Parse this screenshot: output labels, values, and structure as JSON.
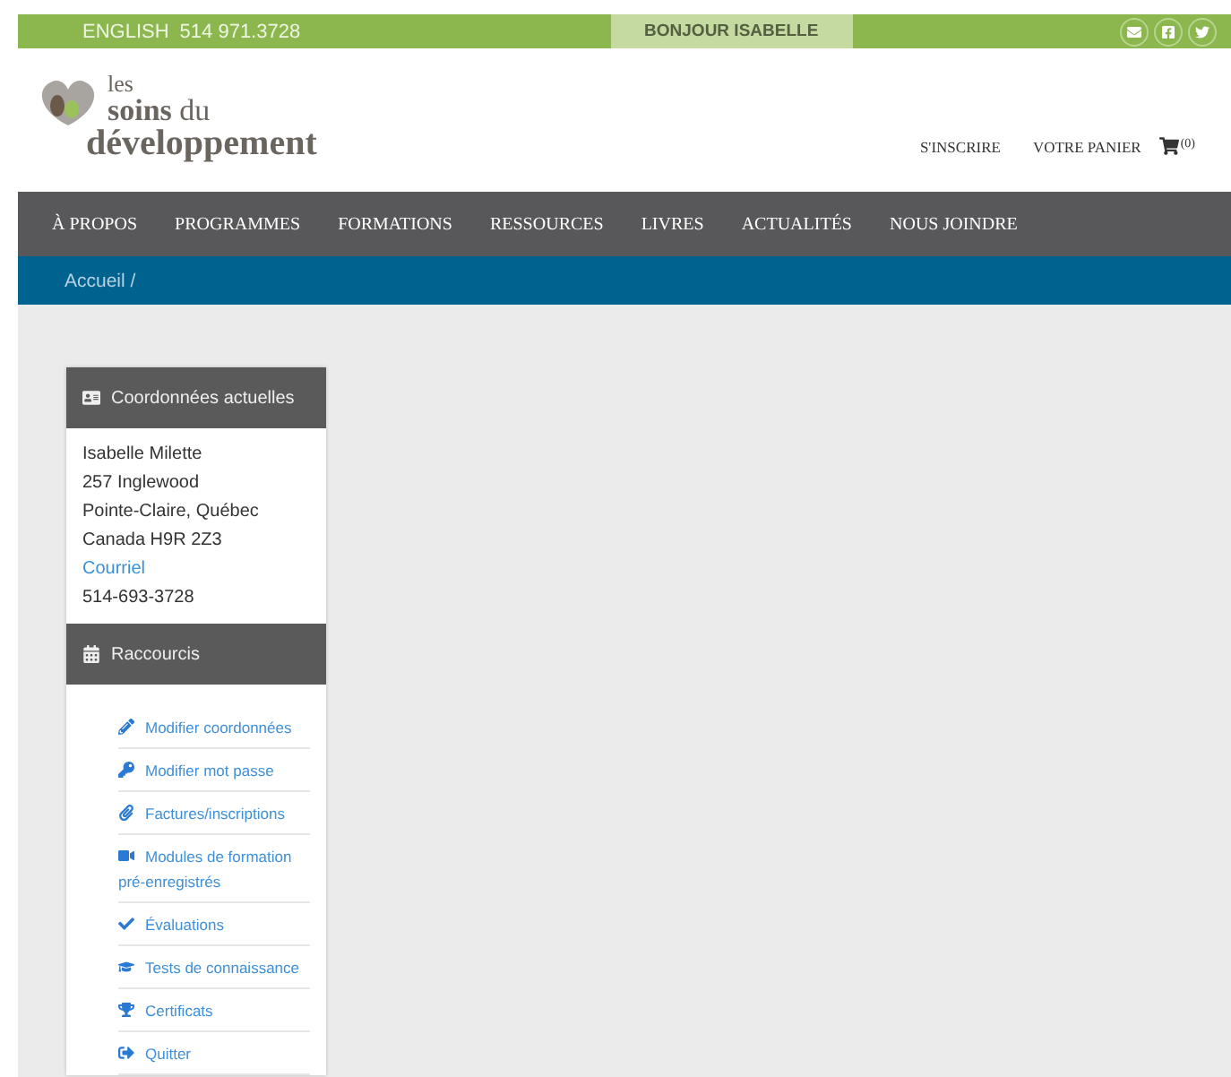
{
  "top_bar": {
    "language": "ENGLISH",
    "phone": "514 971.3728",
    "greeting": "BONJOUR ISABELLE"
  },
  "header": {
    "logo": {
      "line_1": "les",
      "line_2_bold": "soins",
      "line_2_rest": "du",
      "line_3": "développement"
    },
    "links": [
      "S'INSCRIRE",
      "VOTRE PANIER"
    ],
    "cart_count": "(0)"
  },
  "nav": [
    "À PROPOS",
    "PROGRAMMES",
    "FORMATIONS",
    "RESSOURCES",
    "LIVRES",
    "ACTUALITÉS",
    "NOUS JOINDRE"
  ],
  "breadcrumb": "Accueil /",
  "contact_card": {
    "title": "Coordonnées actuelles",
    "lines": [
      {
        "kind": "text",
        "text": "Isabelle Milette"
      },
      {
        "kind": "text",
        "text": "257 Inglewood"
      },
      {
        "kind": "text",
        "text": "Pointe-Claire, Québec"
      },
      {
        "kind": "text",
        "text": "Canada H9R 2Z3"
      },
      {
        "kind": "link",
        "text": "Courriel"
      },
      {
        "kind": "text",
        "text": "514-693-3728"
      }
    ]
  },
  "shortcuts": {
    "title": "Raccourcis",
    "items": [
      "Modifier coordonnées",
      "Modifier mot passe",
      "Factures/inscriptions",
      "Modules de formation pré-enregistrés",
      "Évaluations",
      "Tests de connaissance",
      "Certificats",
      "Quitter"
    ]
  }
}
